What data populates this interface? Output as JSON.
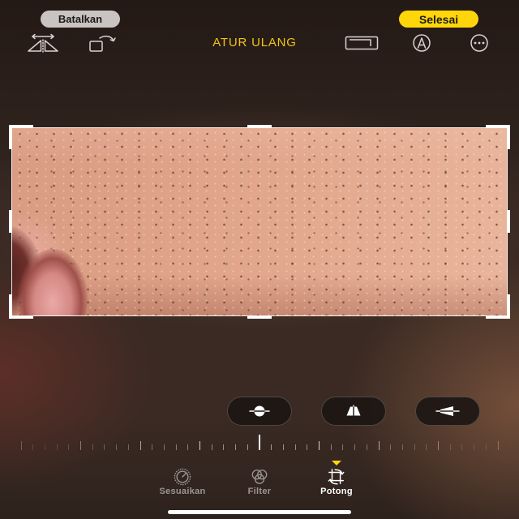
{
  "header": {
    "cancel_label": "Batalkan",
    "done_label": "Selesai",
    "reset_label": "ATUR ULANG"
  },
  "toolbar": {
    "left_icons": [
      "flip-icon",
      "rotate-icon"
    ],
    "right_icons": [
      "aspect-ratio-icon",
      "markup-icon",
      "more-icon"
    ]
  },
  "adjust_modes": [
    {
      "icon": "straighten-icon"
    },
    {
      "icon": "vertical-perspective-icon"
    },
    {
      "icon": "horizontal-perspective-icon"
    }
  ],
  "straighten_slider": {
    "value": 0
  },
  "tabs": [
    {
      "label": "Sesuaikan",
      "icon": "adjust-dial-icon",
      "selected": false
    },
    {
      "label": "Filter",
      "icon": "filters-icon",
      "selected": false
    },
    {
      "label": "Potong",
      "icon": "crop-rotate-icon",
      "selected": true
    }
  ],
  "colors": {
    "accent": "#ffd60a",
    "reset_text": "#f2c318",
    "cancel_bg": "#c9c4c2",
    "icon": "#d9d3d0",
    "tab_active": "#ffffff",
    "tab_inactive": "#9b9694"
  }
}
